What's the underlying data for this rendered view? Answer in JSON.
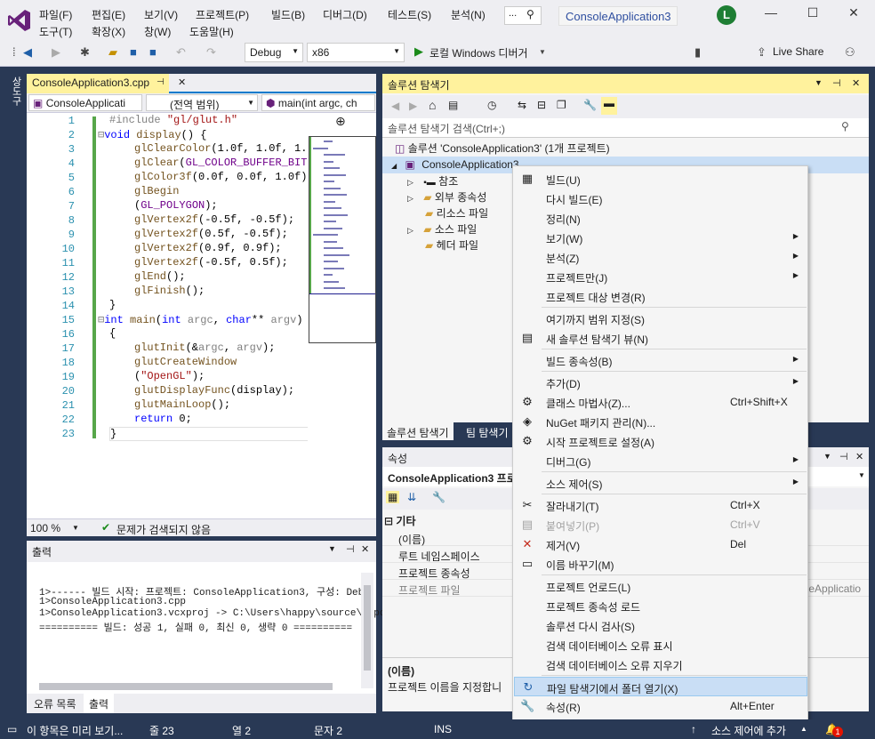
{
  "menus": [
    "파일(F)",
    "편집(E)",
    "보기(V)",
    "프로젝트(P)",
    "빌드(B)",
    "디버그(D)",
    "테스트(S)",
    "분석(N)",
    "도구(T)",
    "확장(X)",
    "창(W)",
    "도움말(H)"
  ],
  "title": "ConsoleApplication3",
  "avatar": "L",
  "toolbar": {
    "config": "Debug",
    "platform": "x86",
    "run": "로컬 Windows 디버거",
    "live_share": "Live Share"
  },
  "side_tab": "상도구",
  "editor": {
    "tab": "ConsoleApplication3.cpp",
    "nav1": "ConsoleApplicati",
    "nav2": "(전역 범위)",
    "nav3": "main(int argc, ch",
    "zoom": "100 %",
    "issues": "문제가 검색되지 않음"
  },
  "output": {
    "title": "출력",
    "lines": [
      "1>------ 빌드 시작: 프로젝트: ConsoleApplication3, 구성: Deb",
      "1>ConsoleApplication3.cpp",
      "1>ConsoleApplication3.vcxproj -> C:\\Users\\happy\\source\\repos",
      "========== 빌드: 성공 1, 실패 0, 최신 0, 생략 0 =========="
    ],
    "tab_errors": "오류 목록",
    "tab_output": "출력"
  },
  "solution_explorer": {
    "title": "솔루션 탐색기",
    "search": "솔루션 탐색기 검색(Ctrl+;)",
    "solution": "솔루션 'ConsoleApplication3' (1개 프로젝트)",
    "project": "ConsoleApplication3",
    "nodes": [
      "참조",
      "외부 종속성",
      "리소스 파일",
      "소스 파일",
      "헤더 파일"
    ],
    "tab1": "솔루션 탐색기",
    "tab2": "팀 탐색기"
  },
  "properties": {
    "title": "속성",
    "object": "ConsoleApplication3 프로",
    "category": "기타",
    "rows": [
      "(이름)",
      "루트 네임스페이스",
      "프로젝트 종속성",
      "프로젝트 파일"
    ],
    "right_value": "oleApplicatio",
    "desc_title": "(이름)",
    "desc": "프로젝트 이름을 지정합니"
  },
  "context_menu": [
    {
      "label": "빌드(U)",
      "icon": "build-icon"
    },
    {
      "label": "다시 빌드(E)"
    },
    {
      "label": "정리(N)"
    },
    {
      "label": "보기(W)",
      "sub": true
    },
    {
      "label": "분석(Z)",
      "sub": true
    },
    {
      "label": "프로젝트만(J)",
      "sub": true
    },
    {
      "label": "프로젝트 대상 변경(R)"
    },
    {
      "label": "여기까지 범위 지정(S)"
    },
    {
      "label": "새 솔루션 탐색기 뷰(N)",
      "icon": "new-view-icon"
    },
    {
      "label": "빌드 종속성(B)",
      "sub": true
    },
    {
      "label": "추가(D)",
      "sub": true
    },
    {
      "label": "클래스 마법사(Z)...",
      "shortcut": "Ctrl+Shift+X",
      "icon": "class-wizard-icon"
    },
    {
      "label": "NuGet 패키지 관리(N)...",
      "icon": "nuget-icon"
    },
    {
      "label": "시작 프로젝트로 설정(A)",
      "icon": "gear-icon"
    },
    {
      "label": "디버그(G)",
      "sub": true
    },
    {
      "label": "소스 제어(S)",
      "sub": true
    },
    {
      "label": "잘라내기(T)",
      "shortcut": "Ctrl+X",
      "icon": "scissors-icon"
    },
    {
      "label": "붙여넣기(P)",
      "shortcut": "Ctrl+V",
      "icon": "paste-icon",
      "disabled": true
    },
    {
      "label": "제거(V)",
      "shortcut": "Del",
      "icon": "delete-icon"
    },
    {
      "label": "이름 바꾸기(M)",
      "icon": "rename-icon"
    },
    {
      "label": "프로젝트 언로드(L)"
    },
    {
      "label": "프로젝트 종속성 로드"
    },
    {
      "label": "솔루션 다시 검사(S)"
    },
    {
      "label": "검색 데이터베이스 오류 표시"
    },
    {
      "label": "검색 데이터베이스 오류 지우기"
    },
    {
      "label": "파일 탐색기에서 폴더 열기(X)",
      "icon": "open-folder-icon",
      "highlight": true
    },
    {
      "label": "속성(R)",
      "shortcut": "Alt+Enter",
      "icon": "wrench-icon"
    }
  ],
  "status": {
    "message": "이 항목은 미리 보기...",
    "line": "줄 23",
    "col": "열 2",
    "char": "문자 2",
    "ins": "INS",
    "source_control": "소스 제어에 추가",
    "notifications": "1"
  },
  "colors": {
    "accent": "#007acc",
    "title_blue": "#2f4fa0",
    "status_bg": "#293955",
    "green_change": "#57a64a"
  }
}
